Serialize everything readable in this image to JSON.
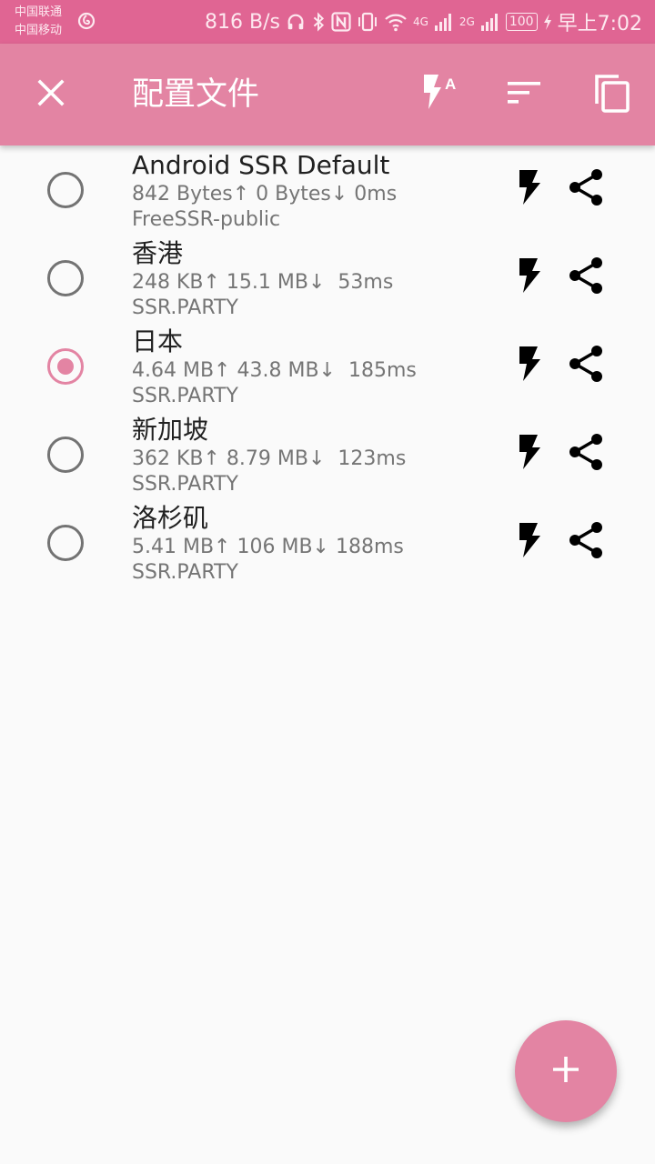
{
  "status_bar": {
    "carrier_1": "中国联通",
    "carrier_2": "中国移动",
    "net_speed": "816 B/s",
    "net_4g": "4G",
    "net_2g": "2G",
    "battery": "100",
    "time": "早上7:02"
  },
  "toolbar": {
    "title": "配置文件"
  },
  "profiles": [
    {
      "name": "Android SSR Default",
      "stats": "842 Bytes↑ 0 Bytes↓ 0ms",
      "group": "FreeSSR-public",
      "selected": false
    },
    {
      "name": "香港",
      "stats": "248 KB↑ 15.1 MB↓  53ms",
      "group": "SSR.PARTY",
      "selected": false
    },
    {
      "name": "日本",
      "stats": "4.64 MB↑ 43.8 MB↓  185ms",
      "group": "SSR.PARTY",
      "selected": true
    },
    {
      "name": "新加坡",
      "stats": "362 KB↑ 8.79 MB↓  123ms",
      "group": "SSR.PARTY",
      "selected": false
    },
    {
      "name": "洛杉矶",
      "stats": "5.41 MB↑ 106 MB↓ 188ms",
      "group": "SSR.PARTY",
      "selected": false
    }
  ],
  "icons": {
    "close": "close-icon",
    "test_all": "flash-auto-icon",
    "sort": "sort-icon",
    "copy": "copy-icon",
    "test": "flash-icon",
    "share": "share-icon",
    "add": "plus-icon"
  },
  "colors": {
    "status_bar": "#e06593",
    "toolbar": "#e384a3",
    "accent": "#e384a3",
    "background": "#fafafa"
  }
}
